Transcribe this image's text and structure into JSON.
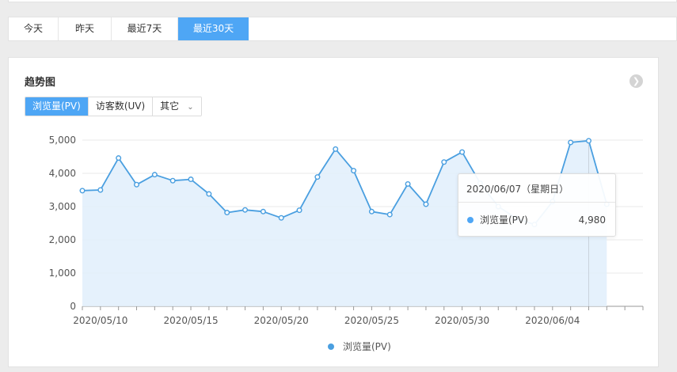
{
  "tabs": [
    {
      "label": "今天",
      "active": false
    },
    {
      "label": "昨天",
      "active": false
    },
    {
      "label": "最近7天",
      "active": false
    },
    {
      "label": "最近30天",
      "active": true
    }
  ],
  "card": {
    "title": "趋势图",
    "more_icon": "chevron-right-circle-icon"
  },
  "metric_tabs": [
    {
      "label": "浏览量(PV)",
      "active": true
    },
    {
      "label": "访客数(UV)",
      "active": false
    },
    {
      "label": "其它",
      "active": false,
      "dropdown": true
    }
  ],
  "colors": {
    "accent": "#4ea6f5",
    "line": "#4a9fe0",
    "area": "#e1eefb"
  },
  "chart_data": {
    "type": "area",
    "x": [
      "2020/05/09",
      "2020/05/10",
      "2020/05/11",
      "2020/05/12",
      "2020/05/13",
      "2020/05/14",
      "2020/05/15",
      "2020/05/16",
      "2020/05/17",
      "2020/05/18",
      "2020/05/19",
      "2020/05/20",
      "2020/05/21",
      "2020/05/22",
      "2020/05/23",
      "2020/05/24",
      "2020/05/25",
      "2020/05/26",
      "2020/05/27",
      "2020/05/28",
      "2020/05/29",
      "2020/05/30",
      "2020/05/31",
      "2020/06/01",
      "2020/06/02",
      "2020/06/03",
      "2020/06/04",
      "2020/06/05",
      "2020/06/06",
      "2020/06/07",
      "2020/06/08"
    ],
    "x_tick_labels": [
      "2020/05/10",
      "2020/05/15",
      "2020/05/20",
      "2020/05/25",
      "2020/05/30",
      "2020/06/04"
    ],
    "series": [
      {
        "name": "浏览量(PV)",
        "values": [
          3480,
          3500,
          4460,
          3660,
          3960,
          3780,
          3820,
          3380,
          2820,
          2900,
          2850,
          2660,
          2890,
          3890,
          4730,
          4080,
          2850,
          2760,
          3680,
          3070,
          4340,
          4640,
          3700,
          3000,
          2650,
          2460,
          3150,
          4930,
          4980,
          3070
        ]
      }
    ],
    "yticks": [
      0,
      1000,
      2000,
      3000,
      4000,
      5000
    ],
    "ytick_labels": [
      "0",
      "1,000",
      "2,000",
      "3,000",
      "4,000",
      "5,000"
    ],
    "ylim": [
      0,
      5000
    ],
    "grid": true,
    "legend": "bottom-center",
    "highlight_index": 28
  },
  "tooltip": {
    "date": "2020/06/07（星期日）",
    "series_name": "浏览量(PV)",
    "value": "4,980"
  },
  "legend": {
    "label": "浏览量(PV)"
  }
}
